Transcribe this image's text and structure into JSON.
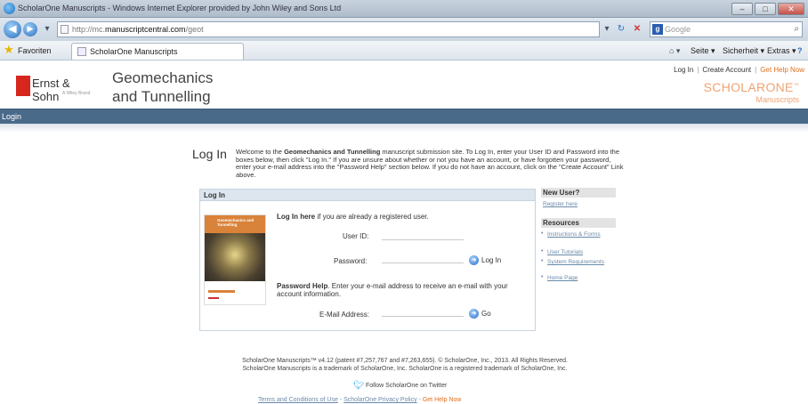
{
  "browser": {
    "window_title": "ScholarOne Manuscripts - Windows Internet Explorer provided by John Wiley and Sons Ltd",
    "url_prefix": "http://mc.",
    "url_host": "manuscriptcentral.com",
    "url_path": "/geot",
    "search_placeholder": "Google",
    "favorites_label": "Favoriten",
    "tab_label": "ScholarOne Manuscripts",
    "commands": {
      "page": "Seite ▾",
      "security": "Sicherheit ▾",
      "extras": "Extras ▾"
    }
  },
  "header": {
    "publisher_logo_text": "Ernst & Sohn",
    "publisher_logo_sub": "A Wiley Brand",
    "journal_line1": "Geomechanics",
    "journal_line2": "and Tunnelling",
    "links": {
      "login": "Log In",
      "create_account": "Create Account",
      "help": "Get Help Now"
    },
    "brand_main": "SCHOLARONE",
    "brand_tm": "™",
    "brand_sub": "Manuscripts"
  },
  "navbar": {
    "login": "Login"
  },
  "intro": {
    "heading": "Log In",
    "welcome_pre": "Welcome to the ",
    "welcome_journal": "Geomechanics and Tunnelling",
    "welcome_post": " manuscript submission site. To Log In, enter your User ID and Password into the boxes below, then click \"Log In.\" If you are unsure about whether or not you have an account, or have forgotten your password, enter your e-mail address into the \"Password Help\" section below. If you do not have an account, click on the \"Create Account\" Link above."
  },
  "login_panel": {
    "title": "Log In",
    "cover_title": "Geomechanics and Tunnelling",
    "login_here_bold": "Log In here",
    "login_here_rest": " if you are already a registered user.",
    "user_id_label": "User ID:",
    "password_label": "Password:",
    "login_button": "Log In",
    "password_help_bold": "Password Help",
    "password_help_rest": ". Enter your e-mail address to receive an e-mail with your account information.",
    "email_label": "E-Mail Address:",
    "go_button": "Go"
  },
  "sidebar": {
    "new_user_heading": "New User?",
    "register_link": "Register here",
    "resources_heading": "Resources",
    "resources": [
      "Instructions & Forms",
      "User Tutorials",
      "System Requirements",
      "Home Page"
    ]
  },
  "footer": {
    "copyright_line1": "ScholarOne Manuscripts™ v4.12 (patent #7,257,767 and #7,263,655). © ScholarOne, Inc., 2013. All Rights Reserved.",
    "copyright_line2": "ScholarOne Manuscripts is a trademark of ScholarOne, Inc. ScholarOne is a registered trademark of ScholarOne, Inc.",
    "twitter": "Follow ScholarOne on Twitter",
    "terms": "Terms and Conditions of Use",
    "privacy": "ScholarOne Privacy Policy",
    "help": "Get Help Now",
    "separator": " - "
  },
  "colors": {
    "navbar": "#4a6a8a",
    "brand_orange": "#f0a372",
    "link": "#6a8aa8",
    "logo_red": "#d7261e"
  },
  "icons": [
    "ie-icon",
    "back-icon",
    "forward-icon",
    "refresh-icon",
    "stop-icon",
    "favorites-star-icon",
    "go-arrow-icon",
    "twitter-icon"
  ]
}
